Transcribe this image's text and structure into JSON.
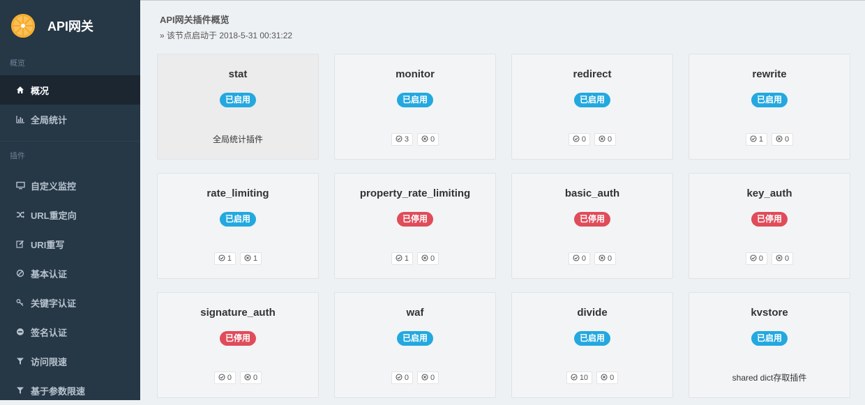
{
  "brand": {
    "title": "API网关"
  },
  "sidebar": {
    "sections": [
      {
        "label": "概览",
        "items": [
          {
            "label": "概况",
            "icon": "home-icon",
            "active": true
          },
          {
            "label": "全局统计",
            "icon": "bar-chart-icon",
            "active": false
          }
        ]
      },
      {
        "label": "插件",
        "items": [
          {
            "label": "自定义监控",
            "icon": "monitor-icon"
          },
          {
            "label": "URL重定向",
            "icon": "shuffle-icon"
          },
          {
            "label": "URI重写",
            "icon": "edit-icon"
          },
          {
            "label": "基本认证",
            "icon": "ban-icon"
          },
          {
            "label": "关键字认证",
            "icon": "key-icon"
          },
          {
            "label": "签名认证",
            "icon": "minus-circle-icon"
          },
          {
            "label": "访问限速",
            "icon": "filter-icon"
          },
          {
            "label": "基于参数限速",
            "icon": "filter-icon"
          }
        ]
      }
    ]
  },
  "header": {
    "title": "API网关插件概览",
    "subtitle": "» 该节点启动于 2018-5-31 00:31:22"
  },
  "colors": {
    "enabled": "#23a8df",
    "disabled": "#e04c5a",
    "sidebar": "#263746"
  },
  "plugins": [
    {
      "name": "stat",
      "status": "已启用",
      "enabled": true,
      "desc": "全局统计插件"
    },
    {
      "name": "monitor",
      "status": "已启用",
      "enabled": true,
      "ok": "3",
      "err": "0"
    },
    {
      "name": "redirect",
      "status": "已启用",
      "enabled": true,
      "ok": "0",
      "err": "0"
    },
    {
      "name": "rewrite",
      "status": "已启用",
      "enabled": true,
      "ok": "1",
      "err": "0"
    },
    {
      "name": "rate_limiting",
      "status": "已启用",
      "enabled": true,
      "ok": "1",
      "err": "1"
    },
    {
      "name": "property_rate_limiting",
      "status": "已停用",
      "enabled": false,
      "ok": "1",
      "err": "0"
    },
    {
      "name": "basic_auth",
      "status": "已停用",
      "enabled": false,
      "ok": "0",
      "err": "0"
    },
    {
      "name": "key_auth",
      "status": "已停用",
      "enabled": false,
      "ok": "0",
      "err": "0"
    },
    {
      "name": "signature_auth",
      "status": "已停用",
      "enabled": false,
      "ok": "0",
      "err": "0"
    },
    {
      "name": "waf",
      "status": "已启用",
      "enabled": true,
      "ok": "0",
      "err": "0"
    },
    {
      "name": "divide",
      "status": "已启用",
      "enabled": true,
      "ok": "10",
      "err": "0"
    },
    {
      "name": "kvstore",
      "status": "已启用",
      "enabled": true,
      "desc": "shared dict存取插件"
    }
  ]
}
